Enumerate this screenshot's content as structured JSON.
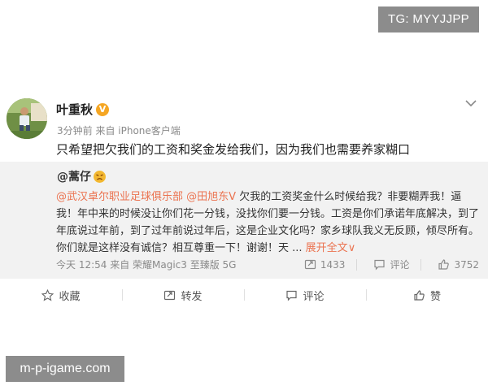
{
  "watermarks": {
    "top_right": "TG: MYYJJPP",
    "bottom_left": "m-p-igame.com"
  },
  "post": {
    "author": "叶重秋",
    "verified_badge": "V",
    "meta": "3分钟前 来自 iPhone客户端",
    "text": "只希望把欠我们的工资和奖金发给我们，因为我们也需要养家糊口"
  },
  "repost": {
    "author": "@蒿仔",
    "mention_1": "@武汉卓尔职业足球俱乐部",
    "mention_2": "@田旭东V",
    "body": " 欠我的工资奖金什么时候给我？非要糊弄我！逼我！年中来的时候没让你们花一分钱，没找你们要一分钱。工资是你们承诺年底解决，到了年底说过年前，到了过年前说过年后，这是企业文化吗？家乡球队我义无反顾，倾尽所有。你们就是这样没有诚信？相互尊重一下！谢谢！天 ... ",
    "expand_label": "展开全文",
    "expand_arrow": "∨",
    "footer_meta": "今天 12:54 来自 荣耀Magic3 至臻版 5G",
    "reposts": "1433",
    "comments_label": "评论",
    "likes": "3752"
  },
  "actions": {
    "favorite": "收藏",
    "repost": "转发",
    "comment": "评论",
    "like": "赞"
  },
  "colors": {
    "accent": "#eb7350",
    "badge": "#f5a623",
    "repost_bg": "#f2f2f2"
  }
}
